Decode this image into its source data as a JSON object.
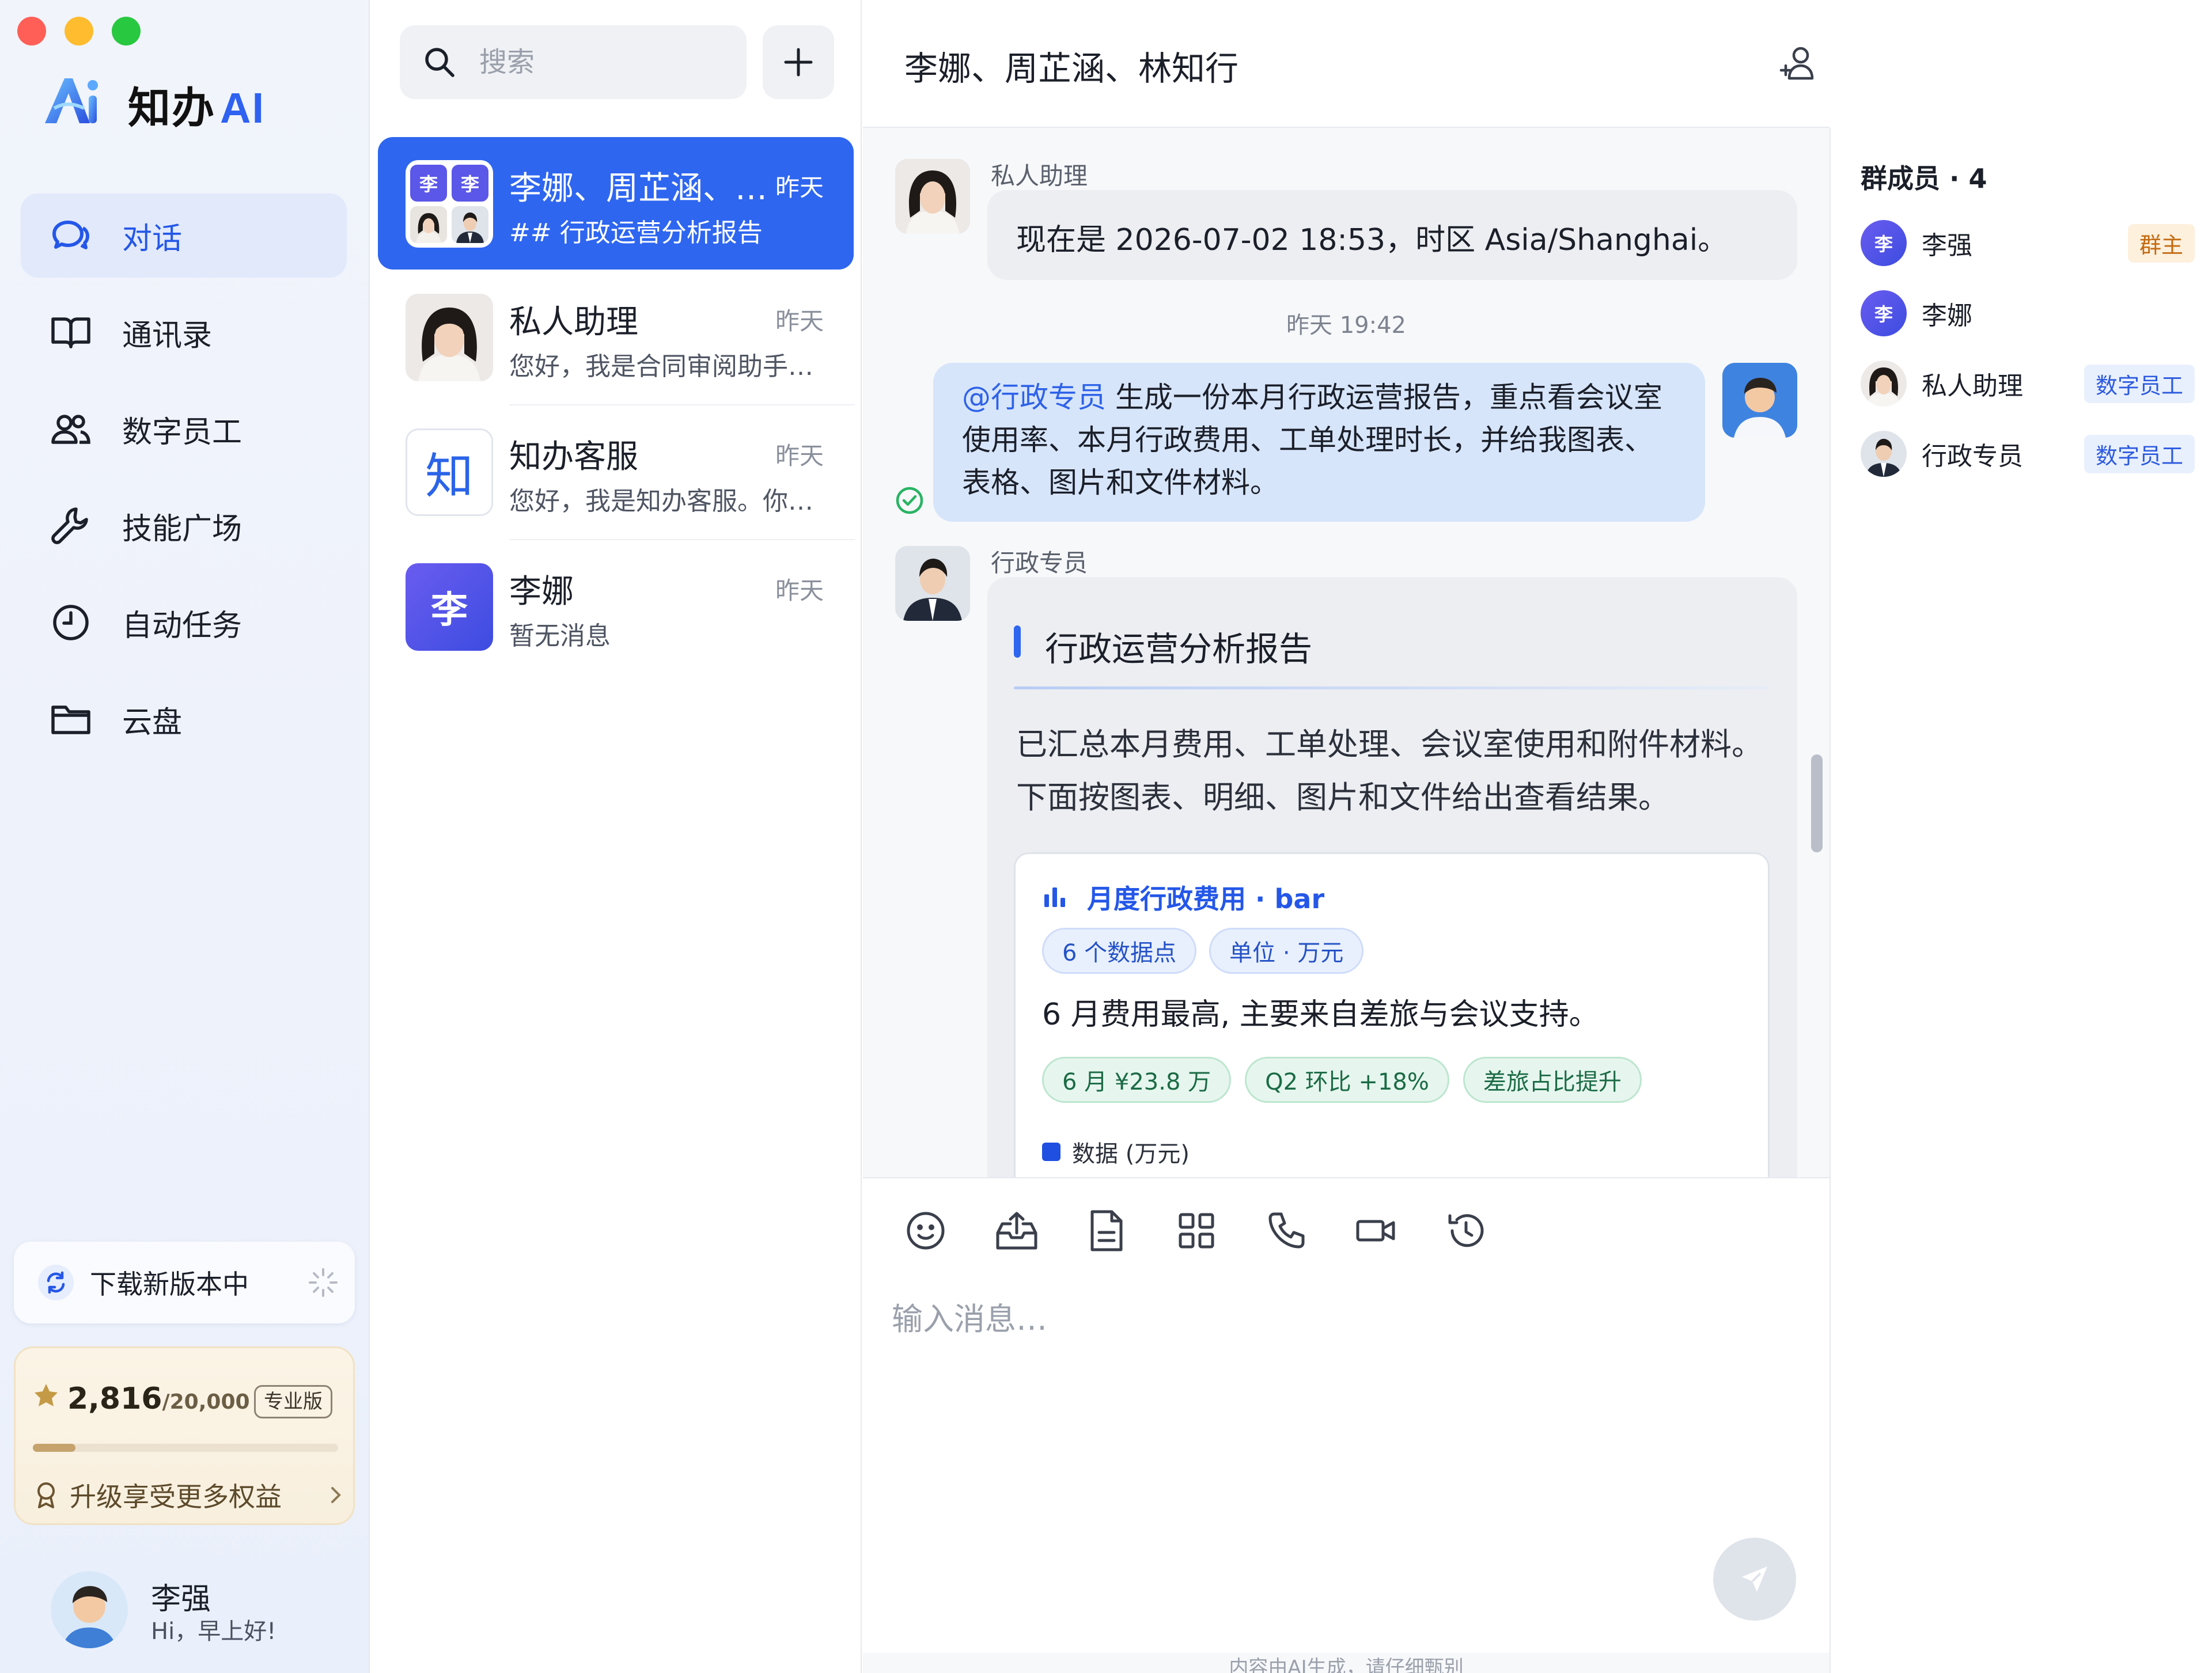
{
  "app": {
    "brand": "知办",
    "brand_ai": "AI"
  },
  "colors": {
    "accent": "#2e66f0",
    "close": "#ff5f57",
    "minimize": "#febc2e",
    "zoom": "#28c840",
    "chart_bar": "#1f4fe0"
  },
  "sidebar": {
    "nav": [
      {
        "label": "对话",
        "icon": "chat-bubbles-icon",
        "active": true
      },
      {
        "label": "通讯录",
        "icon": "book-icon"
      },
      {
        "label": "数字员工",
        "icon": "people-icon"
      },
      {
        "label": "技能广场",
        "icon": "wrench-icon"
      },
      {
        "label": "自动任务",
        "icon": "clock-icon"
      },
      {
        "label": "云盘",
        "icon": "folder-icon"
      }
    ],
    "download": {
      "label": "下载新版本中"
    },
    "plan": {
      "points": "2,816",
      "points_total": "/20,000",
      "badge": "专业版",
      "progress": 0.14,
      "upgrade_label": "升级享受更多权益"
    },
    "user": {
      "name": "李强",
      "greeting": "Hi，早上好!"
    }
  },
  "conv_list": {
    "search_placeholder": "搜索",
    "items": [
      {
        "name": "李娜、周芷涵、…",
        "time": "昨天",
        "preview": "## 行政运营分析报告",
        "initials": [
          "李",
          "李"
        ]
      },
      {
        "name": "私人助理",
        "time": "昨天",
        "preview": "您好，我是合同审阅助手…"
      },
      {
        "name": "知办客服",
        "time": "昨天",
        "preview": "您好，我是知办客服。你…",
        "avatar_char": "知"
      },
      {
        "name": "李娜",
        "time": "昨天",
        "preview": "暂无消息",
        "avatar_char": "李"
      }
    ]
  },
  "chat": {
    "title": "李娜、周芷涵、林知行",
    "messages": {
      "m1": {
        "sender": "私人助理",
        "text": "现在是 2026-07-02 18:53，时区 Asia/Shanghai。"
      },
      "time_sep": "昨天 19:42",
      "m2": {
        "mention": "@行政专员",
        "line1": " 生成一份本月行政运营报告，重点看会议室",
        "line2": "使用率、本月行政费用、工单处理时长，并给我图表、",
        "line3": "表格、图片和文件材料。"
      },
      "m3": {
        "sender": "行政专员",
        "report_title": "行政运营分析报告",
        "para1": "已汇总本月费用、工单处理、会议室使用和附件材料。",
        "para2": "下面按图表、明细、图片和文件给出查看结果。",
        "chart_card": {
          "title": "月度行政费用 · bar",
          "pills": [
            "6 个数据点",
            "单位 · 万元"
          ],
          "note": "6 月费用最高, 主要来自差旅与会议支持。",
          "highlights": [
            "6 月 ¥23.8 万",
            "Q2 环比 +18%",
            "差旅占比提升"
          ],
          "legend": "数据 (万元)"
        }
      }
    },
    "composer": {
      "placeholder": "输入消息…",
      "tools": [
        "emoji-icon",
        "upload-icon",
        "document-icon",
        "grid-icon",
        "phone-icon",
        "video-icon",
        "history-icon"
      ]
    },
    "disclaimer": "内容由AI生成，请仔细甄别"
  },
  "members": {
    "title": "群成员 · 4",
    "items": [
      {
        "name": "李强",
        "tag": "群主",
        "avatar_char": "李"
      },
      {
        "name": "李娜",
        "tag": "",
        "avatar_char": "李"
      },
      {
        "name": "私人助理",
        "tag": "数字员工"
      },
      {
        "name": "行政专员",
        "tag": "数字员工"
      }
    ]
  }
}
